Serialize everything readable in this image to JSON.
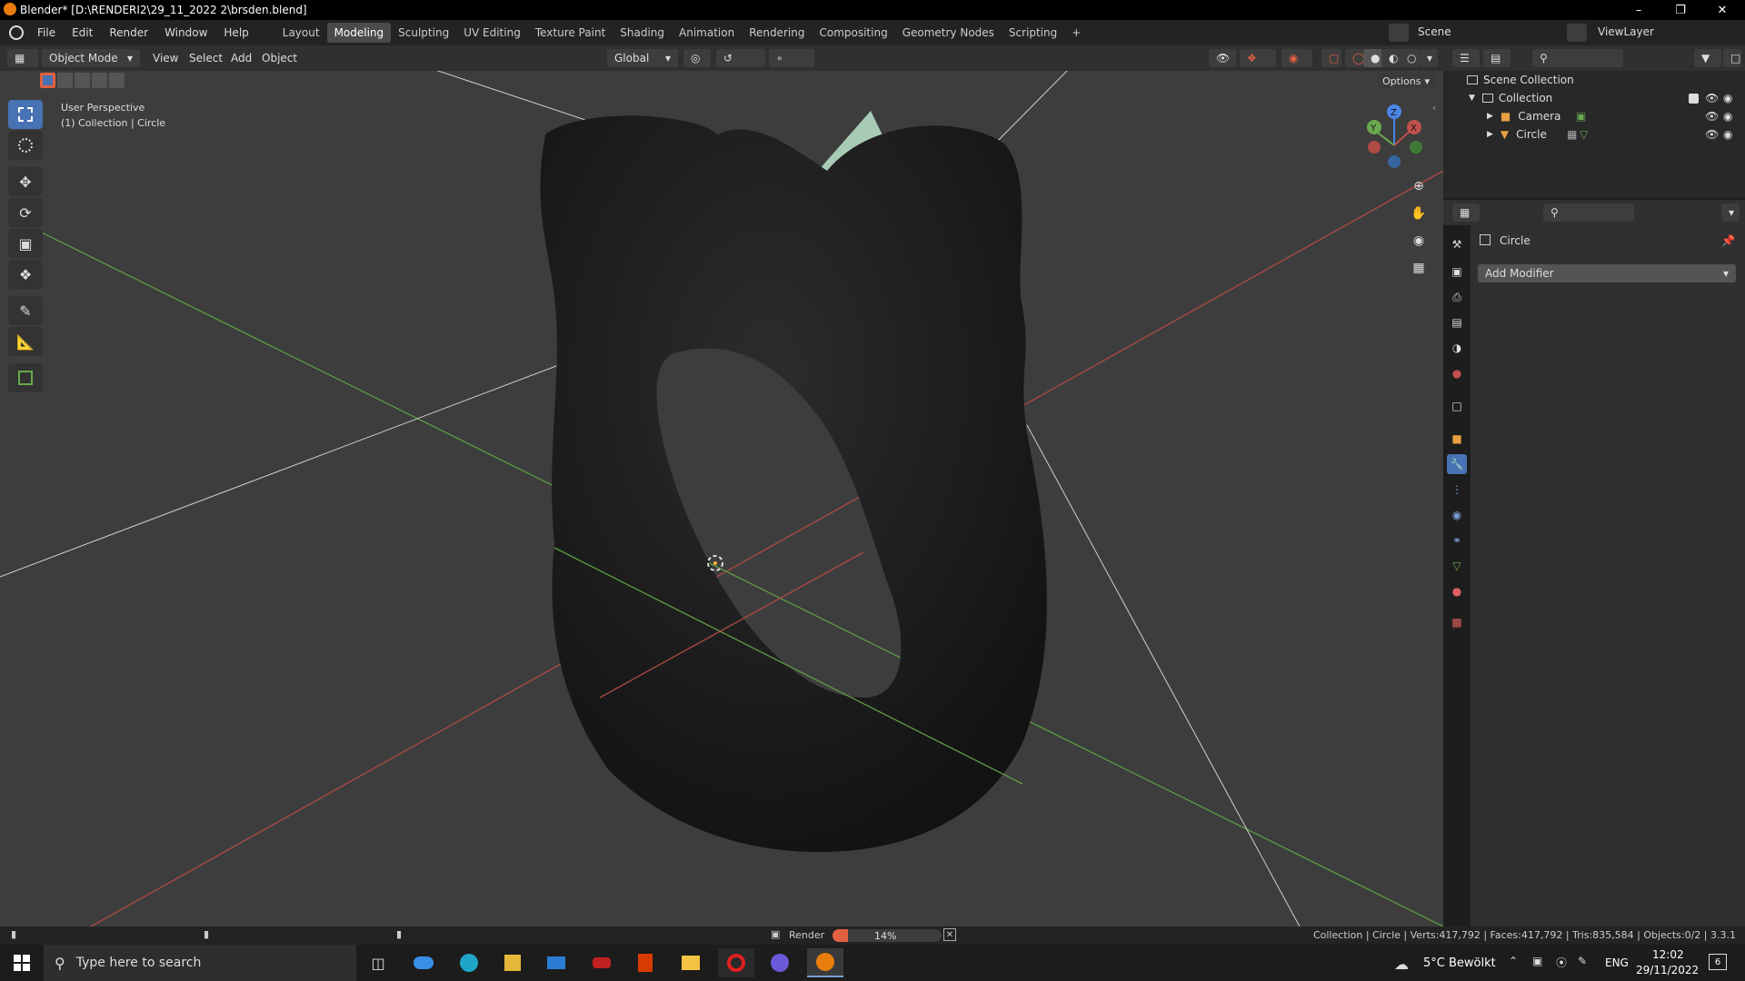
{
  "window": {
    "title": "Blender* [D:\\RENDERI2\\29_11_2022 2\\brsden.blend]"
  },
  "menu": {
    "items": [
      "File",
      "Edit",
      "Render",
      "Window",
      "Help"
    ]
  },
  "workspaces": [
    "Layout",
    "Modeling",
    "Sculpting",
    "UV Editing",
    "Texture Paint",
    "Shading",
    "Animation",
    "Rendering",
    "Compositing",
    "Geometry Nodes",
    "Scripting"
  ],
  "active_workspace": "Modeling",
  "scene": {
    "label": "Scene"
  },
  "viewlayer": {
    "label": "ViewLayer"
  },
  "viewport_header": {
    "mode": "Object Mode",
    "view": "View",
    "select": "Select",
    "add": "Add",
    "object": "Object",
    "orientation": "Global",
    "options": "Options"
  },
  "viewport": {
    "perspective": "User Perspective",
    "collection_info": "(1) Collection | Circle"
  },
  "gizmo": {
    "z": "Z",
    "y": "Y",
    "x": "X"
  },
  "outliner": {
    "root": "Scene Collection",
    "collection": "Collection",
    "items": [
      "Camera",
      "Circle"
    ]
  },
  "properties": {
    "object_name": "Circle",
    "add_modifier": "Add Modifier"
  },
  "statusbar": {
    "render_label": "Render",
    "progress_text": "14%",
    "progress": 0.14,
    "stats": "Collection | Circle | Verts:417,792 | Faces:417,792 | Tris:835,584 | Objects:0/2 | 3.3.1"
  },
  "taskbar": {
    "search_placeholder": "Type here to search",
    "weather": "5°C  Bewölkt",
    "lang": "ENG",
    "time": "12:02",
    "date": "29/11/2022",
    "notifications": "6"
  },
  "colors": {
    "accent": "#4772b3",
    "x_axis": "#c0504a",
    "y_axis": "#6aa84f",
    "z_axis": "#4a86e8"
  }
}
